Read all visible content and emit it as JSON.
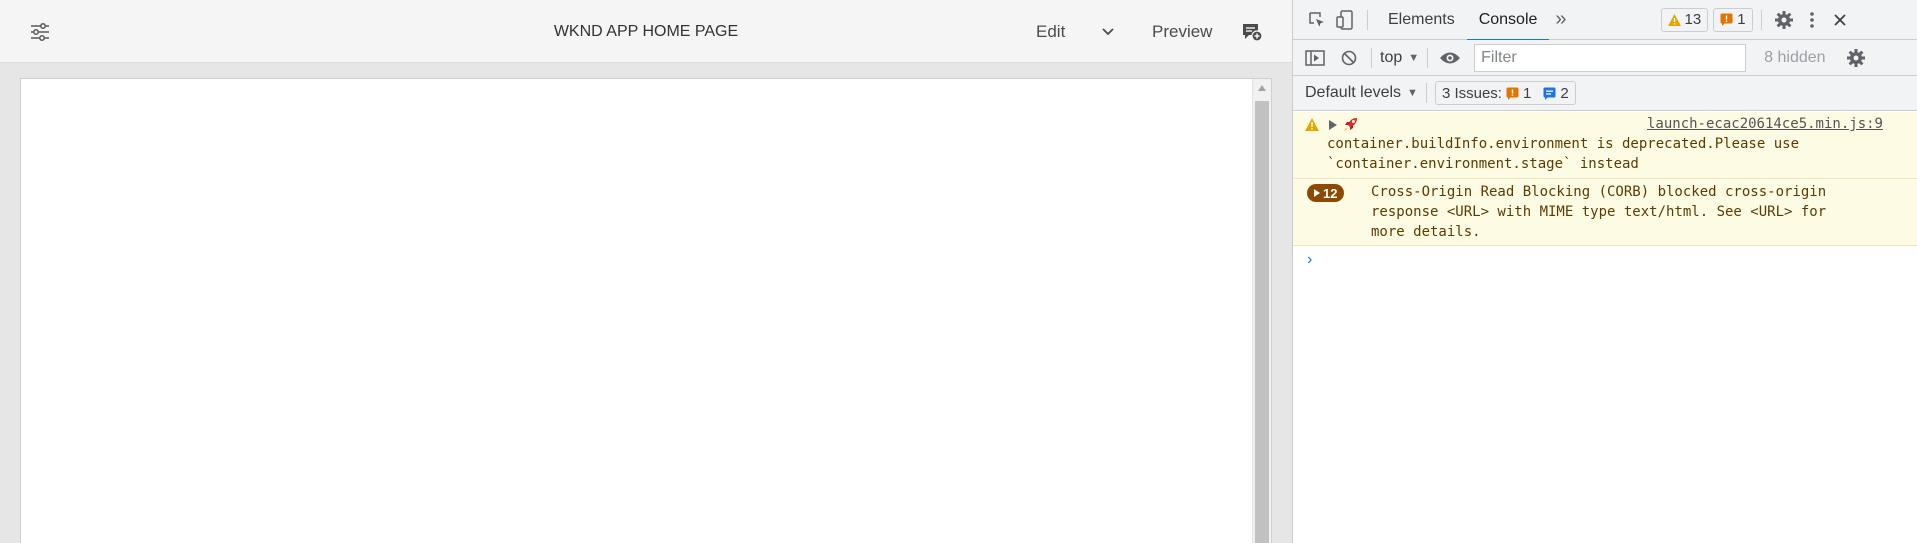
{
  "editor": {
    "page_title": "WKND APP HOME PAGE",
    "edit_label": "Edit",
    "preview_label": "Preview",
    "icons": {
      "properties": "sliders-icon",
      "mode_dropdown": "chevron-down-icon",
      "annotations": "annotation-add-icon"
    }
  },
  "devtools": {
    "tabs": [
      "Elements",
      "Console"
    ],
    "active_tab": "Console",
    "more_tabs": "»",
    "warnings_count": "13",
    "errors_count": "1",
    "context": "top",
    "filter_placeholder": "Filter",
    "hidden_count": "8 hidden",
    "levels": "Default levels",
    "issues_label": "3 Issues:",
    "issues_warning_count": "1",
    "issues_info_count": "2",
    "messages": [
      {
        "source": "launch-ecac20614ce5.min.js:9",
        "text_line1": "container.buildInfo.environment is deprecated.Please use",
        "text_line2": "`container.environment.stage` instead"
      },
      {
        "repeat_count": "12",
        "text_line1": "Cross-Origin Read Blocking (CORB) blocked cross-origin",
        "text_line2": "response <URL> with MIME type text/html. See <URL> for",
        "text_line3": "more details."
      }
    ],
    "prompt_symbol": "›",
    "colors": {
      "accent": "#1a73e8",
      "warning_bg": "#fefbe5",
      "warning_icon": "#e8a600",
      "error_badge": "#8c4a00"
    }
  }
}
